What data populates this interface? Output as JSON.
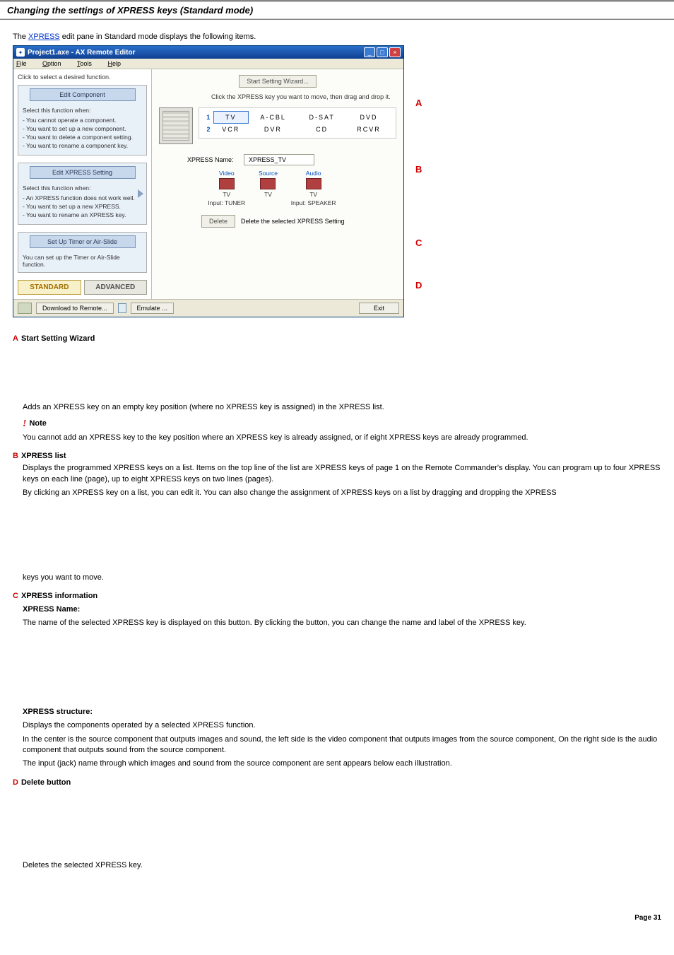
{
  "page_title": "Changing the settings of XPRESS keys (Standard mode)",
  "intro_pre": "The ",
  "intro_link": "XPRESS",
  "intro_post": " edit pane in Standard mode displays the following items.",
  "window": {
    "title": "Project1.axe - AX Remote Editor",
    "menu": {
      "file": "File",
      "option": "Option",
      "tools": "Tools",
      "help": "Help"
    },
    "left_hint": "Click to select a desired function.",
    "card1": {
      "btn": "Edit Component",
      "head": "Select this function when:",
      "items": [
        "- You cannot operate a component.",
        "- You want to set up a new component.",
        "- You want to delete a component setting.",
        "- You want to rename a component key."
      ]
    },
    "card2": {
      "btn": "Edit XPRESS Setting",
      "head": "Select this function when:",
      "items": [
        "- An XPRESS function does not work well.",
        "- You want to set up a new XPRESS.",
        "- You want to rename an XPRESS key."
      ]
    },
    "card3": {
      "btn": "Set Up Timer or Air-Slide",
      "desc": "You can set up the Timer or Air-Slide function."
    },
    "mode_std": "STANDARD",
    "mode_adv": "ADVANCED",
    "right": {
      "start_btn": "Start Setting Wizard...",
      "hint": "Click the XPRESS key you want to move, then drag and drop it.",
      "grid": {
        "r1n": "1",
        "r1c1": "TV",
        "r1c2": "A-CBL",
        "r1c3": "D-SAT",
        "r1c4": "DVD",
        "r2n": "2",
        "r2c1": "VCR",
        "r2c2": "DVR",
        "r2c3": "CD",
        "r2c4": "RCVR"
      },
      "name_lab": "XPRESS Name:",
      "name_val": "XPRESS_TV",
      "struct": {
        "video": {
          "hdr": "Video",
          "dev": "TV",
          "inp": "Input: TUNER"
        },
        "source": {
          "hdr": "Source",
          "dev": "TV",
          "inp": ""
        },
        "audio": {
          "hdr": "Audio",
          "dev": "TV",
          "inp": "Input: SPEAKER"
        }
      },
      "delete_btn": "Delete",
      "delete_txt": "Delete the selected XPRESS Setting"
    },
    "footer": {
      "download": "Download to Remote...",
      "emulate": "Emulate ...",
      "exit": "Exit"
    }
  },
  "callouts": {
    "A": "A",
    "B": "B",
    "C": "C",
    "D": "D"
  },
  "secA": {
    "title": "Start Setting Wizard",
    "p1": "Adds an XPRESS key on an empty key position (where no XPRESS key is assigned) in the XPRESS list.",
    "note_label": "Note",
    "note": "You cannot add an XPRESS key to the key position where an XPRESS key is already assigned, or if eight XPRESS keys are already programmed."
  },
  "secB": {
    "title": "XPRESS list",
    "p1": "Displays the programmed XPRESS keys on a list. Items on the top line of the list are XPRESS keys of page 1 on the Remote Commander's display. You can program up to four XPRESS keys on each line (page), up to eight XPRESS keys on two lines (pages).",
    "p2": "By clicking an XPRESS key on a list, you can edit it. You can also change the assignment of XPRESS keys on a list by dragging and dropping the XPRESS",
    "p3": "keys you want to move."
  },
  "secC": {
    "title": "XPRESS information",
    "name_head": "XPRESS Name:",
    "name_p": "The name of the selected XPRESS key is displayed on this button. By clicking the button, you can change the name and label of the XPRESS key.",
    "struct_head": "XPRESS structure:",
    "struct_p1": "Displays the components operated by a selected XPRESS function.",
    "struct_p2": "In the center is the source component that outputs images and sound, the left side is the video component that outputs images from the source component, On the right side is the audio component that outputs sound from the source component.",
    "struct_p3": "The input (jack) name through which images and sound from the source component are sent appears below each illustration."
  },
  "secD": {
    "title": "Delete button",
    "p1": "Deletes the selected XPRESS key."
  },
  "page_num": "Page 31"
}
